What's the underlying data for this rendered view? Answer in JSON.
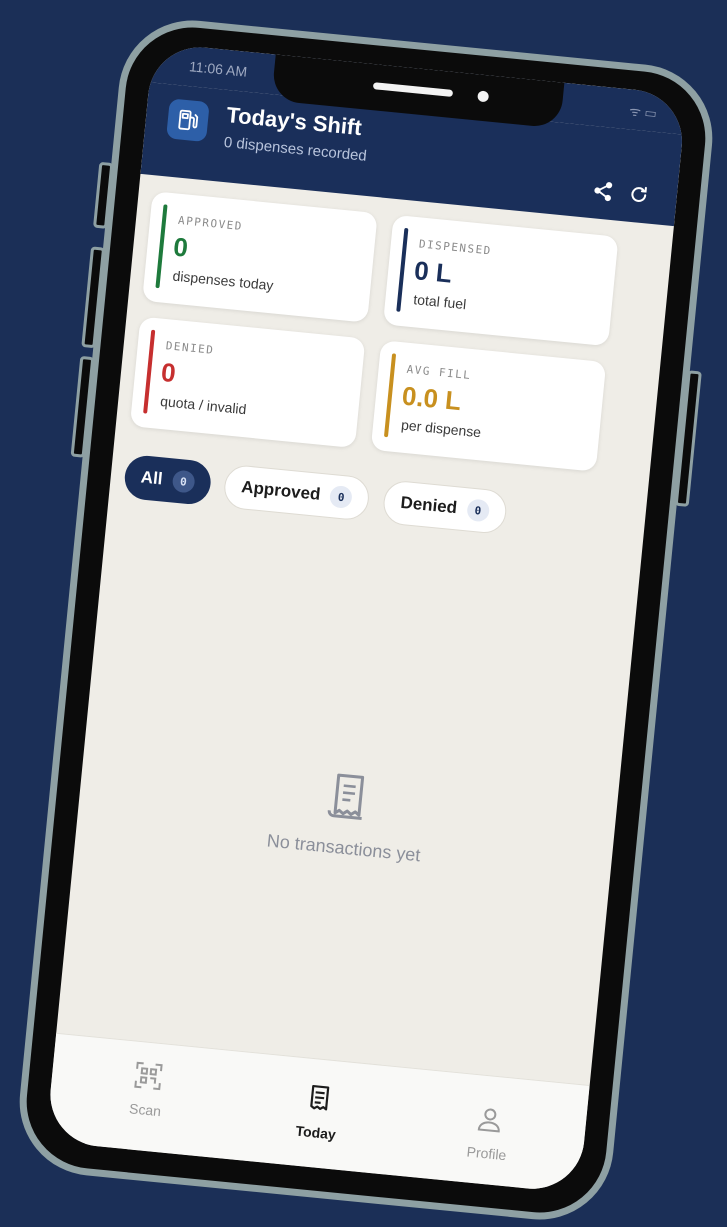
{
  "status_bar": {
    "time": "11:06 AM",
    "system": "ᯤ ▭"
  },
  "header": {
    "title": "Today's Shift",
    "subtitle": "0 dispenses recorded",
    "app_icon": "fuel-pump-icon",
    "actions": [
      "share-icon",
      "refresh-icon"
    ]
  },
  "stats": [
    {
      "label": "APPROVED",
      "value": "0",
      "sub": "dispenses today",
      "color": "#1e7a3c"
    },
    {
      "label": "DISPENSED",
      "value": "0 L",
      "sub": "total fuel",
      "color": "#1a2f5a"
    },
    {
      "label": "DENIED",
      "value": "0",
      "sub": "quota / invalid",
      "color": "#c62f2f"
    },
    {
      "label": "AVG FILL",
      "value": "0.0 L",
      "sub": "per dispense",
      "color": "#c8901f"
    }
  ],
  "filters": [
    {
      "label": "All",
      "count": "0",
      "active": true
    },
    {
      "label": "Approved",
      "count": "0",
      "active": false
    },
    {
      "label": "Denied",
      "count": "0",
      "active": false
    }
  ],
  "empty_state": {
    "icon": "receipt-icon",
    "text": "No transactions yet"
  },
  "tabs": [
    {
      "label": "Scan",
      "icon": "qr-scan-icon",
      "active": false
    },
    {
      "label": "Today",
      "icon": "receipt-icon",
      "active": true
    },
    {
      "label": "Profile",
      "icon": "user-icon",
      "active": false
    }
  ],
  "colors": {
    "primary": "#1a2f5a",
    "background": "#1b2f57",
    "screen_bg": "#efede7"
  }
}
